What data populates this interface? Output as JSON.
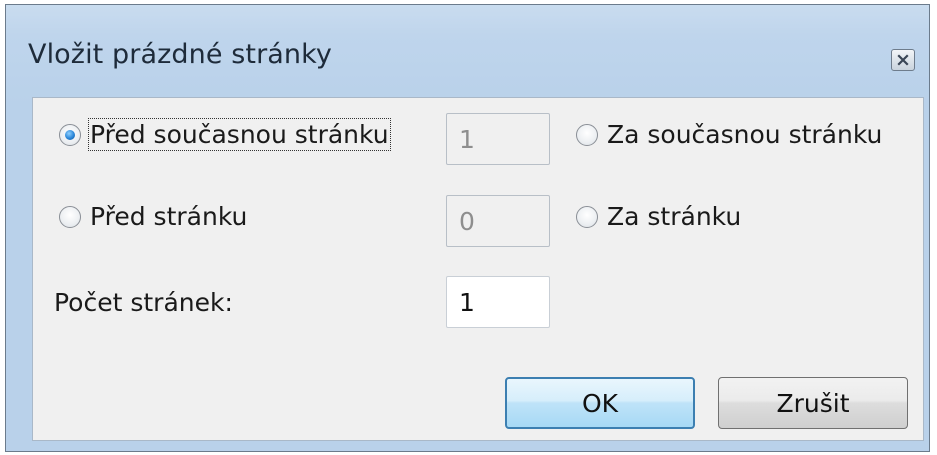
{
  "window": {
    "title": "Vložit prázdné stránky",
    "close_icon": "close-icon"
  },
  "options": {
    "before_current": {
      "label": "Před současnou stránku",
      "checked": true
    },
    "after_current": {
      "label": "Za současnou stránku",
      "checked": false
    },
    "before_page": {
      "label": "Před stránku",
      "checked": false
    },
    "after_page": {
      "label": "Za stránku",
      "checked": false
    }
  },
  "fields": {
    "current_page_value": "1",
    "page_number_value": "0",
    "page_count_label": "Počet stránek:",
    "page_count_value": "1"
  },
  "buttons": {
    "ok_label": "OK",
    "cancel_label": "Zrušit"
  }
}
